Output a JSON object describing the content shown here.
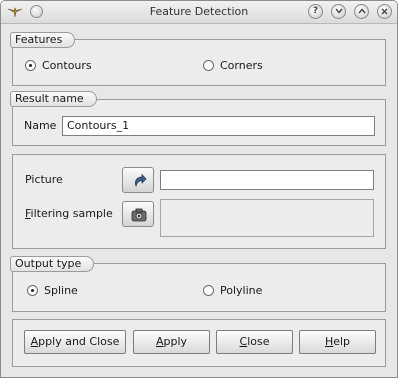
{
  "window": {
    "title": "Feature Detection"
  },
  "features_group": {
    "title": "Features",
    "options": [
      {
        "label": "Contours",
        "checked": true
      },
      {
        "label": "Corners",
        "checked": false
      }
    ]
  },
  "result_group": {
    "title": "Result name",
    "name_label": "Name",
    "name_value": "Contours_1"
  },
  "inputs_group": {
    "picture_label": "Picture",
    "picture_value": "",
    "filtering_label_first": "F",
    "filtering_label_rest": "iltering sample",
    "filtering_value": ""
  },
  "output_group": {
    "title": "Output type",
    "options": [
      {
        "label": "Spline",
        "checked": true
      },
      {
        "label": "Polyline",
        "checked": false
      }
    ]
  },
  "buttons": {
    "apply_close": {
      "mnemonic": "A",
      "rest": "pply and Close"
    },
    "apply": {
      "mnemonic": "A",
      "rest": "pply"
    },
    "close": {
      "mnemonic": "C",
      "rest": "lose"
    },
    "help": {
      "mnemonic": "H",
      "rest": "elp"
    }
  },
  "icons": {
    "app": "salome-wing-icon",
    "help": "question-icon",
    "minimize": "chevron-down-icon",
    "maximize": "chevron-up-icon",
    "close": "close-icon",
    "picture_select": "arrow-select-icon",
    "filter_select": "camera-icon"
  },
  "colors": {
    "window_bg": "#e7e7e7",
    "titlebar": "#dcdcdc"
  }
}
